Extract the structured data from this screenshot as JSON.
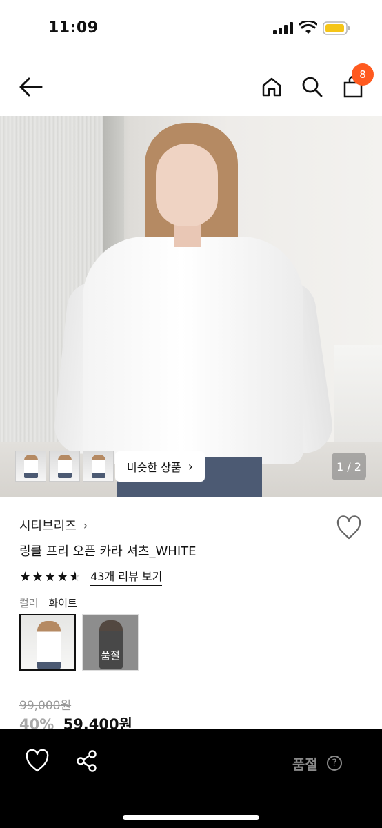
{
  "status_bar": {
    "time": "11:09"
  },
  "header": {
    "cart_count": "8"
  },
  "gallery": {
    "similar_button_label": "비슷한 상품",
    "page_indicator": "1 / 2"
  },
  "product": {
    "brand": "시티브리즈",
    "title": "링클 프리 오픈 카라 셔츠_WHITE",
    "rating": 4.5,
    "review_link": "43개 리뷰 보기",
    "color_label": "컬러",
    "color_value": "화이트",
    "swatches": [
      {
        "name": "화이트",
        "label": ""
      },
      {
        "name": "블랙",
        "label": "품절"
      }
    ],
    "original_price": "99,000원",
    "discount": "40%",
    "final_price": "59,400원"
  },
  "bottom_bar": {
    "soldout_label": "품절",
    "help_symbol": "?"
  }
}
